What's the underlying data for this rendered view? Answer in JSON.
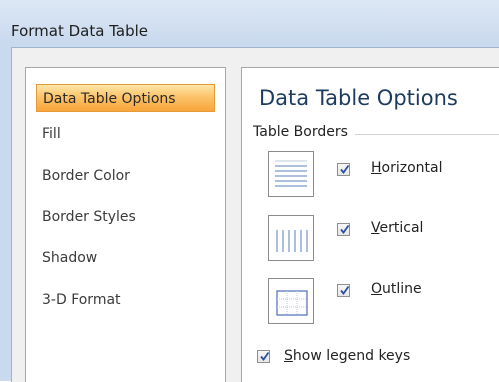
{
  "window": {
    "title": "Format Data Table"
  },
  "sidebar": {
    "items": [
      {
        "label": "Data Table Options",
        "selected": true
      },
      {
        "label": "Fill",
        "selected": false
      },
      {
        "label": "Border Color",
        "selected": false
      },
      {
        "label": "Border Styles",
        "selected": false
      },
      {
        "label": "Shadow",
        "selected": false
      },
      {
        "label": "3-D Format",
        "selected": false
      }
    ]
  },
  "panel": {
    "title": "Data Table Options",
    "group_label": "Table Borders",
    "options": [
      {
        "mnemonic": "H",
        "rest": "orizontal",
        "checked": true,
        "icon": "horizontal-borders-icon"
      },
      {
        "mnemonic": "V",
        "rest": "ertical",
        "checked": true,
        "icon": "vertical-borders-icon"
      },
      {
        "mnemonic": "O",
        "rest": "utline",
        "checked": true,
        "icon": "outline-borders-icon"
      }
    ],
    "legend_keys": {
      "mnemonic": "S",
      "rest": "how legend keys",
      "checked": true
    }
  },
  "colors": {
    "selected_item": "#fcc36a",
    "title_text": "#1d3b5e",
    "window_chrome": "#c9d9ee"
  }
}
